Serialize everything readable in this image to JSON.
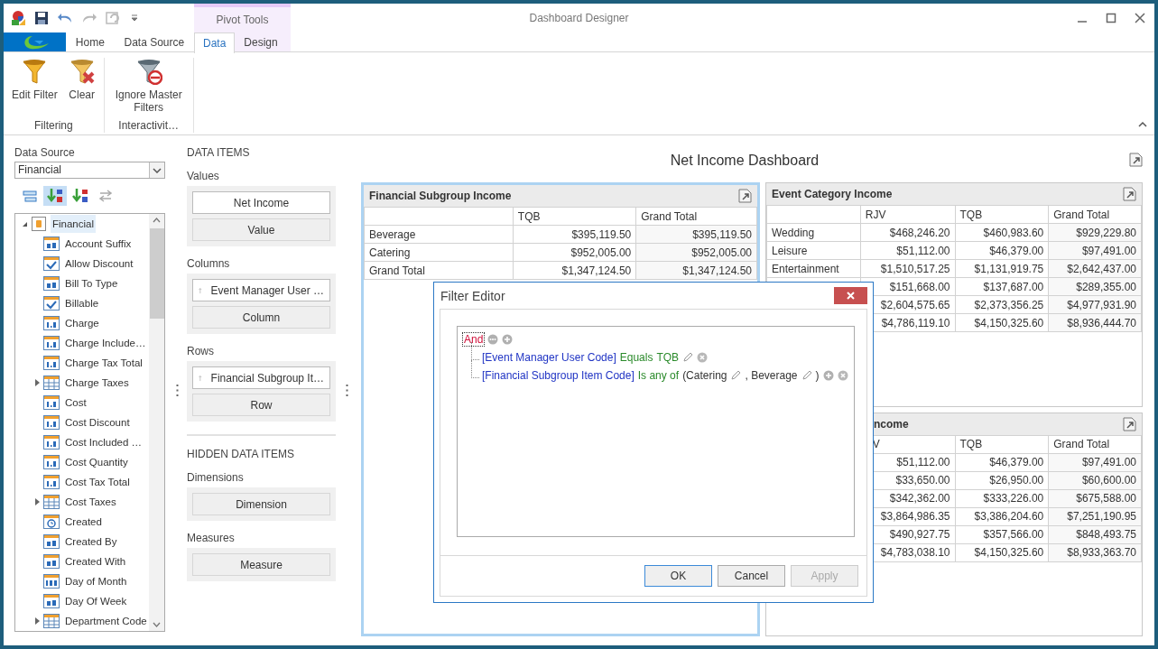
{
  "window": {
    "title": "Dashboard Designer",
    "context_header": "Pivot Tools"
  },
  "tabs": [
    {
      "label": "Home",
      "selected": false,
      "contextual": false
    },
    {
      "label": "Data Source",
      "selected": false,
      "contextual": false
    },
    {
      "label": "Data",
      "selected": true,
      "contextual": true
    },
    {
      "label": "Design",
      "selected": false,
      "contextual": true
    }
  ],
  "ribbon_groups": [
    {
      "caption": "Filtering",
      "buttons": [
        {
          "label": "Edit Filter",
          "kind": "funnel"
        },
        {
          "label": "Clear",
          "kind": "funnel_clear"
        }
      ]
    },
    {
      "caption": "Interactivit…",
      "buttons": [
        {
          "label": "Ignore Master Filters",
          "kind": "funnel_block"
        }
      ]
    }
  ],
  "data_source": {
    "label": "Data Source",
    "value": "Financial"
  },
  "field_toolbar": [
    {
      "kind": "group",
      "selected": false
    },
    {
      "kind": "sort_az",
      "selected": true
    },
    {
      "kind": "sort_za",
      "selected": false
    },
    {
      "kind": "swap",
      "selected": false
    }
  ],
  "field_tree": [
    {
      "label": "Financial",
      "kind": "source",
      "expanded": true,
      "selected": true,
      "children": [
        {
          "label": "Account Suffix",
          "kind": "text"
        },
        {
          "label": "Allow Discount",
          "kind": "boolean"
        },
        {
          "label": "Bill To Type",
          "kind": "text"
        },
        {
          "label": "Billable",
          "kind": "boolean"
        },
        {
          "label": "Charge",
          "kind": "number"
        },
        {
          "label": "Charge Include…",
          "kind": "number"
        },
        {
          "label": "Charge Tax Total",
          "kind": "number"
        },
        {
          "label": "Charge Taxes",
          "kind": "table",
          "expanded": false
        },
        {
          "label": "Cost",
          "kind": "number"
        },
        {
          "label": "Cost Discount",
          "kind": "number"
        },
        {
          "label": "Cost Included …",
          "kind": "number"
        },
        {
          "label": "Cost Quantity",
          "kind": "number"
        },
        {
          "label": "Cost Tax Total",
          "kind": "number"
        },
        {
          "label": "Cost Taxes",
          "kind": "table",
          "expanded": false
        },
        {
          "label": "Created",
          "kind": "datetime"
        },
        {
          "label": "Created By",
          "kind": "text"
        },
        {
          "label": "Created With",
          "kind": "text"
        },
        {
          "label": "Day of Month",
          "kind": "integer"
        },
        {
          "label": "Day Of Week",
          "kind": "text"
        },
        {
          "label": "Department Code",
          "kind": "table",
          "expanded": false
        }
      ]
    }
  ],
  "data_items": {
    "heading": "DATA ITEMS",
    "sections": [
      {
        "title": "Values",
        "items": [
          {
            "label": "Net Income",
            "kind": "measure"
          },
          {
            "label": "Value",
            "kind": "placeholder"
          }
        ]
      },
      {
        "title": "Columns",
        "items": [
          {
            "label": "Event Manager User …",
            "kind": "dimension"
          },
          {
            "label": "Column",
            "kind": "placeholder"
          }
        ]
      },
      {
        "title": "Rows",
        "items": [
          {
            "label": "Financial Subgroup It…",
            "kind": "dimension"
          },
          {
            "label": "Row",
            "kind": "placeholder"
          }
        ]
      }
    ]
  },
  "hidden_data_items": {
    "heading": "HIDDEN DATA ITEMS",
    "sections": [
      {
        "title": "Dimensions",
        "items": [
          {
            "label": "Dimension",
            "kind": "placeholder"
          }
        ]
      },
      {
        "title": "Measures",
        "items": [
          {
            "label": "Measure",
            "kind": "placeholder"
          }
        ]
      }
    ]
  },
  "dashboard": {
    "title": "Net Income Dashboard",
    "panels": [
      {
        "title": "Financial Subgroup Income",
        "selected": true,
        "columns": [
          "TQB",
          "Grand Total"
        ],
        "rows": [
          {
            "label": "Beverage",
            "values": [
              "$395,119.50",
              "$395,119.50"
            ]
          },
          {
            "label": "Catering",
            "values": [
              "$952,005.00",
              "$952,005.00"
            ]
          },
          {
            "label": "Grand Total",
            "values": [
              "$1,347,124.50",
              "$1,347,124.50"
            ]
          }
        ]
      },
      {
        "title": "Event Category Income",
        "selected": false,
        "columns": [
          "RJV",
          "TQB",
          "Grand Total"
        ],
        "rows": [
          {
            "label": "Wedding",
            "values": [
              "$468,246.20",
              "$460,983.60",
              "$929,229.80"
            ]
          },
          {
            "label": "Leisure",
            "values": [
              "$51,112.00",
              "$46,379.00",
              "$97,491.00"
            ]
          },
          {
            "label": "Entertainment",
            "values": [
              "$1,510,517.25",
              "$1,131,919.75",
              "$2,642,437.00"
            ]
          },
          {
            "values": [
              "$151,668.00",
              "$137,687.00",
              "$289,355.00"
            ]
          },
          {
            "values": [
              "$2,604,575.65",
              "$2,373,356.25",
              "$4,977,931.90"
            ]
          },
          {
            "values": [
              "$4,786,119.10",
              "$4,150,325.60",
              "$8,936,444.70"
            ]
          }
        ]
      },
      {
        "title": "ncome",
        "selected": false,
        "columns": [
          "V",
          "TQB",
          "Grand Total"
        ],
        "rows": [
          {
            "values": [
              "$51,112.00",
              "$46,379.00",
              "$97,491.00"
            ]
          },
          {
            "values": [
              "$33,650.00",
              "$26,950.00",
              "$60,600.00"
            ]
          },
          {
            "values": [
              "$342,362.00",
              "$333,226.00",
              "$675,588.00"
            ]
          },
          {
            "values": [
              "$3,864,986.35",
              "$3,386,204.60",
              "$7,251,190.95"
            ]
          },
          {
            "values": [
              "$490,927.75",
              "$357,566.00",
              "$848,493.75"
            ]
          },
          {
            "values": [
              "$4,783,038.10",
              "$4,150,325.60",
              "$8,933,363.70"
            ]
          }
        ]
      }
    ]
  },
  "filter_editor": {
    "title": "Filter Editor",
    "root": {
      "tokens": [
        {
          "kind": "group",
          "text": "And",
          "focused": true
        },
        {
          "kind": "menu"
        },
        {
          "kind": "add"
        }
      ],
      "children": [
        {
          "tokens": [
            {
              "kind": "field",
              "text": "[Event Manager User Code]"
            },
            {
              "kind": "operator",
              "text": "Equals"
            },
            {
              "kind": "value",
              "text": "TQB"
            },
            {
              "kind": "edit"
            },
            {
              "kind": "remove"
            }
          ]
        },
        {
          "tokens": [
            {
              "kind": "field",
              "text": "[Financial Subgroup Item Code]"
            },
            {
              "kind": "operator",
              "text": "Is any of"
            },
            {
              "kind": "list",
              "text": "(Catering"
            },
            {
              "kind": "edit"
            },
            {
              "kind": "list",
              "text": ", Beverage"
            },
            {
              "kind": "edit"
            },
            {
              "kind": "list",
              "text": ")"
            },
            {
              "kind": "add"
            },
            {
              "kind": "remove"
            }
          ]
        }
      ]
    },
    "buttons": [
      {
        "label": "OK",
        "focused": true,
        "disabled": false
      },
      {
        "label": "Cancel",
        "focused": false,
        "disabled": false
      },
      {
        "label": "Apply",
        "focused": false,
        "disabled": true
      }
    ]
  }
}
